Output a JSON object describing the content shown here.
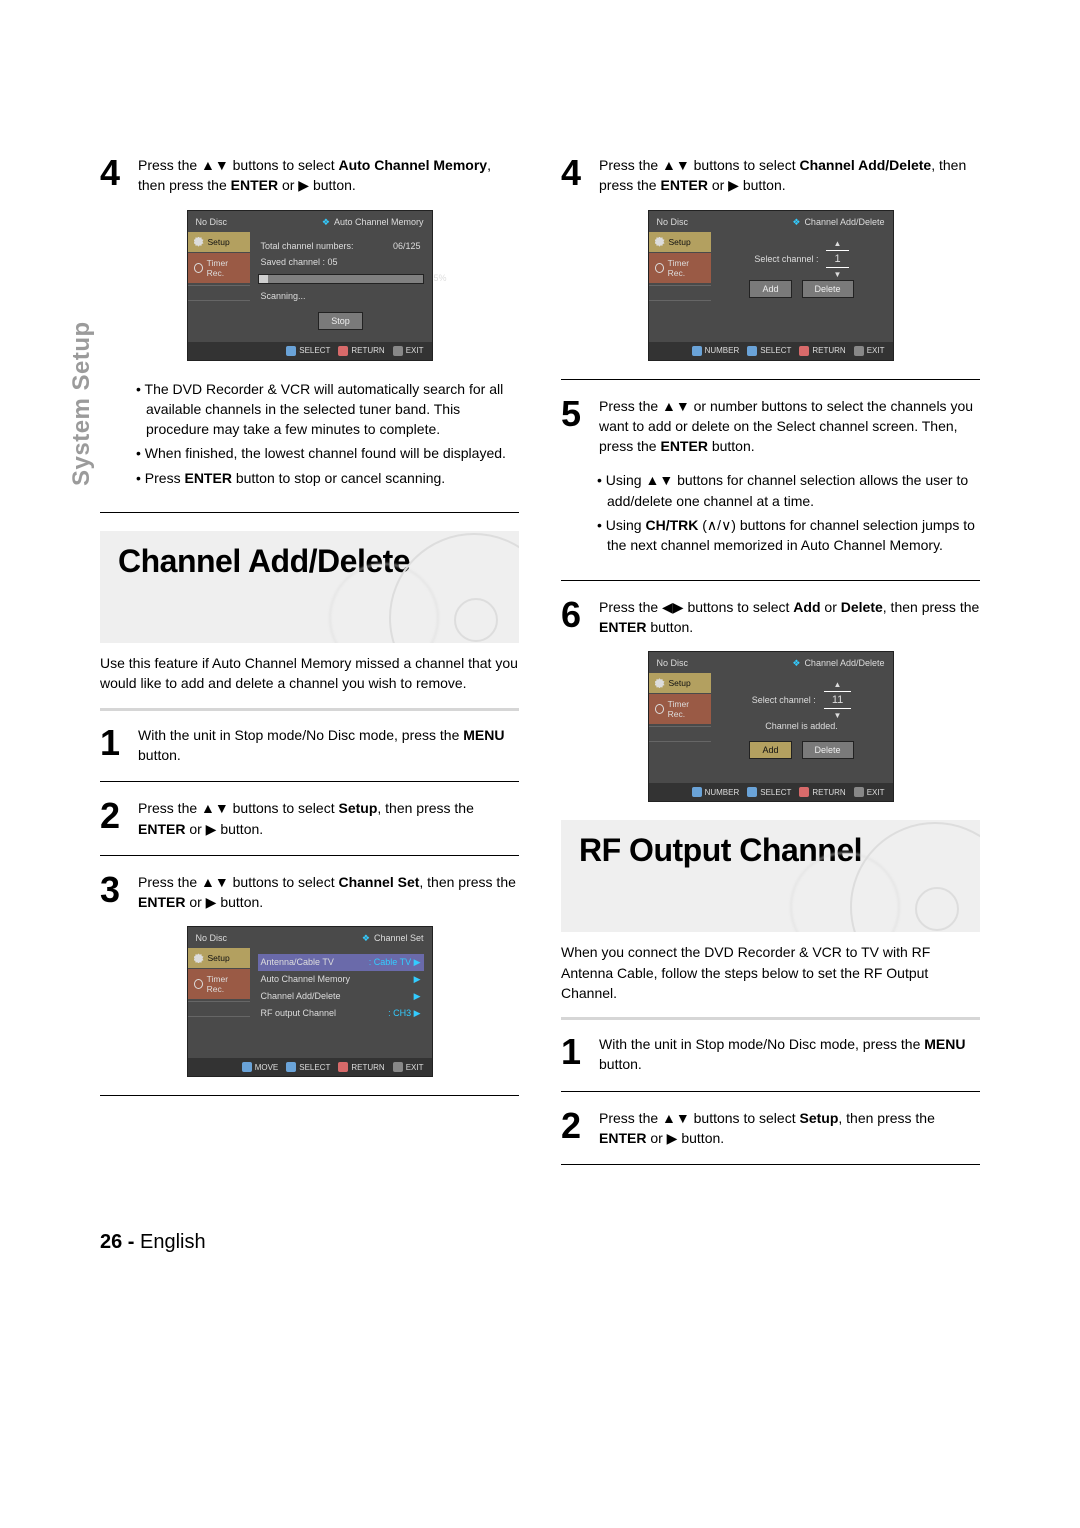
{
  "sideLabel": "System Setup",
  "pageFooter": {
    "num": "26 -",
    "lang": "English"
  },
  "left": {
    "step4": {
      "num": "4",
      "text_a": "Press the ▲▼ buttons to select ",
      "bold1": "Auto Channel Memory",
      "text_b": ", then press the ",
      "bold2": "ENTER",
      "text_c": " or ▶ button."
    },
    "osd1": {
      "noDisc": "No Disc",
      "title": "Auto Channel Memory",
      "setup": "Setup",
      "timerRec": "Timer Rec.",
      "total": "Total channel numbers:",
      "totalVal": "06/125",
      "saved": "Saved channel :   05",
      "pct": "5%",
      "scanning": "Scanning...",
      "stop": "Stop",
      "foot": {
        "select": "SELECT",
        "return": "RETURN",
        "exit": "EXIT"
      }
    },
    "bullets4": [
      "The DVD Recorder & VCR will automatically search for all available channels in the selected tuner band. This procedure may take a few minutes to complete.",
      "When finished, the lowest channel found will be displayed.",
      "Press ENTER button to stop or cancel scanning."
    ],
    "sectionA": "Channel Add/Delete",
    "paraA": "Use this feature if Auto Channel Memory missed a channel that you would like to add and delete a channel you wish to remove.",
    "step1": {
      "num": "1",
      "a": "With the unit in Stop mode/No Disc mode, press the ",
      "b": "MENU",
      "c": " button."
    },
    "step2": {
      "num": "2",
      "a": "Press the ▲▼ buttons to select ",
      "b": "Setup",
      "c": ", then press the ",
      "d": "ENTER",
      "e": " or ▶ button."
    },
    "step3": {
      "num": "3",
      "a": "Press the ▲▼ buttons to select ",
      "b": "Channel Set",
      "c": ", then press the ",
      "d": "ENTER",
      "e": " or ▶ button."
    },
    "osd2": {
      "noDisc": "No Disc",
      "title": "Channel Set",
      "setup": "Setup",
      "timerRec": "Timer Rec.",
      "rows": [
        {
          "l": "Antenna/Cable TV",
          "r": ": Cable TV ▶"
        },
        {
          "l": "Auto Channel Memory",
          "r": "▶"
        },
        {
          "l": "Channel Add/Delete",
          "r": "▶"
        },
        {
          "l": "RF output Channel",
          "r": ": CH3       ▶"
        }
      ],
      "foot": {
        "move": "MOVE",
        "select": "SELECT",
        "return": "RETURN",
        "exit": "EXIT"
      }
    }
  },
  "right": {
    "step4": {
      "num": "4",
      "a": "Press the ▲▼ buttons to select ",
      "b1": "Channel Add/Delete",
      "c": ", then press the ",
      "b2": "ENTER",
      "d": " or ▶ button."
    },
    "osd3": {
      "noDisc": "No Disc",
      "title": "Channel Add/Delete",
      "setup": "Setup",
      "timerRec": "Timer Rec.",
      "selCh": "Select channel :",
      "chNum": "1",
      "add": "Add",
      "delete": "Delete",
      "foot": {
        "number": "NUMBER",
        "select": "SELECT",
        "return": "RETURN",
        "exit": "EXIT"
      }
    },
    "step5": {
      "num": "5",
      "a": "Press the ▲▼ or number buttons to select the channels you want to add or delete on the Select channel screen. Then, press the ",
      "b": "ENTER",
      "c": " button."
    },
    "bullets5": [
      "Using   ▲▼ buttons for channel selection allows the user to add/delete one channel at a time.",
      "Using CH/TRK (∧/∨) buttons for channel selection jumps to the next channel memorized in Auto Channel Memory."
    ],
    "step6": {
      "num": "6",
      "a": "Press the ◀▶ buttons to select ",
      "b1": "Add",
      "mid": " or ",
      "b2": "Delete",
      "c": ", then press the ",
      "b3": "ENTER",
      "d": " button."
    },
    "osd4": {
      "noDisc": "No Disc",
      "title": "Channel Add/Delete",
      "setup": "Setup",
      "timerRec": "Timer Rec.",
      "selCh": "Select channel :",
      "chNum": "11",
      "added": "Channel is added.",
      "add": "Add",
      "delete": "Delete",
      "foot": {
        "number": "NUMBER",
        "select": "SELECT",
        "return": "RETURN",
        "exit": "EXIT"
      }
    },
    "sectionB": "RF Output Channel",
    "paraB": "When you connect the DVD Recorder & VCR to TV with RF Antenna Cable, follow the steps below to set the RF Output Channel.",
    "step1": {
      "num": "1",
      "a": "With the unit in Stop mode/No Disc mode, press the ",
      "b": "MENU",
      "c": " button."
    },
    "step2": {
      "num": "2",
      "a": "Press the ▲▼ buttons to select ",
      "b": "Setup",
      "c": ", then press the ",
      "d": "ENTER",
      "e": " or ▶ button."
    }
  }
}
